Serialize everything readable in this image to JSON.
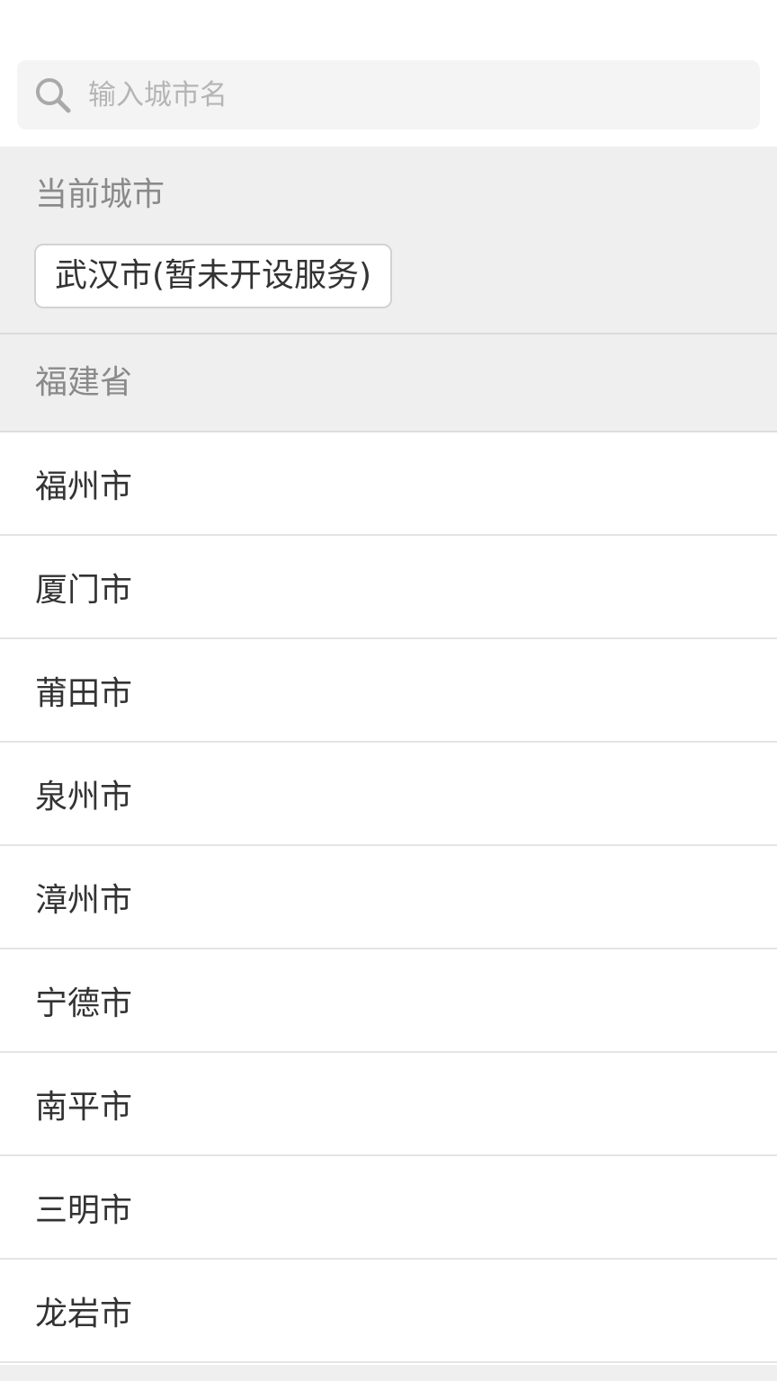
{
  "search": {
    "placeholder": "输入城市名",
    "value": ""
  },
  "current_city": {
    "title": "当前城市",
    "button_label": "武汉市(暂未开设服务)"
  },
  "province": {
    "name": "福建省",
    "cities": [
      {
        "label": "福州市"
      },
      {
        "label": "厦门市"
      },
      {
        "label": "莆田市"
      },
      {
        "label": "泉州市"
      },
      {
        "label": "漳州市"
      },
      {
        "label": "宁德市"
      },
      {
        "label": "南平市"
      },
      {
        "label": "三明市"
      },
      {
        "label": "龙岩市"
      }
    ]
  },
  "icons": {
    "search": "search-icon"
  },
  "colors": {
    "section_bg": "#efefef",
    "search_bg": "#f4f4f4",
    "muted_text": "#8a8a8a",
    "text": "#333333",
    "placeholder": "#b5b5b5"
  }
}
